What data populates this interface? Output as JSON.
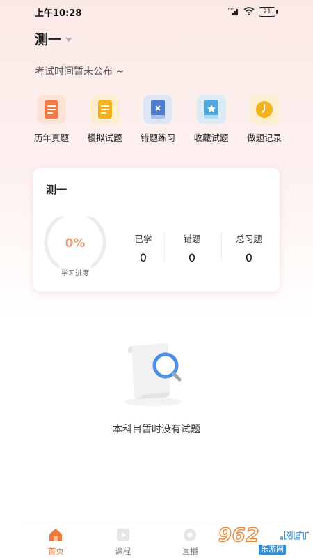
{
  "status_bar": {
    "time": "上午10:28",
    "battery": "21"
  },
  "header": {
    "subject": "测一",
    "exam_notice": "考试时间暂未公布 ~"
  },
  "features": [
    {
      "label": "历年真题",
      "icon": "document-icon",
      "color": "#f07a4a",
      "bg": "#fde3d6"
    },
    {
      "label": "模拟试题",
      "icon": "note-icon",
      "color": "#f5b21c",
      "bg": "#fdeecf"
    },
    {
      "label": "错题练习",
      "icon": "wrong-book-icon",
      "color": "#4f7ccf",
      "bg": "#dde6f6"
    },
    {
      "label": "收藏试题",
      "icon": "star-book-icon",
      "color": "#4fa7df",
      "bg": "#dcecf7"
    },
    {
      "label": "做题记录",
      "icon": "clock-icon",
      "color": "#f5b21c",
      "bg": "#fdeecf"
    }
  ],
  "progress_card": {
    "title": "测一",
    "progress_value": "0%",
    "progress_fraction": 0,
    "progress_label": "学习进度",
    "stats": [
      {
        "label": "已学",
        "value": "0"
      },
      {
        "label": "错题",
        "value": "0"
      },
      {
        "label": "总习题",
        "value": "0"
      }
    ]
  },
  "empty_state": {
    "message": "本科目暂时没有试题"
  },
  "tabbar": [
    {
      "label": "首页",
      "icon": "home-icon",
      "active": true
    },
    {
      "label": "课程",
      "icon": "play-icon",
      "active": false
    },
    {
      "label": "直播",
      "icon": "live-icon",
      "active": false
    }
  ],
  "watermark": {
    "number": "962",
    "suffix": ".NET",
    "name": "乐游网"
  },
  "colors": {
    "accent": "#f07a3a",
    "ring_track": "#f0ebe6",
    "progress_text": "#e9a07a"
  }
}
